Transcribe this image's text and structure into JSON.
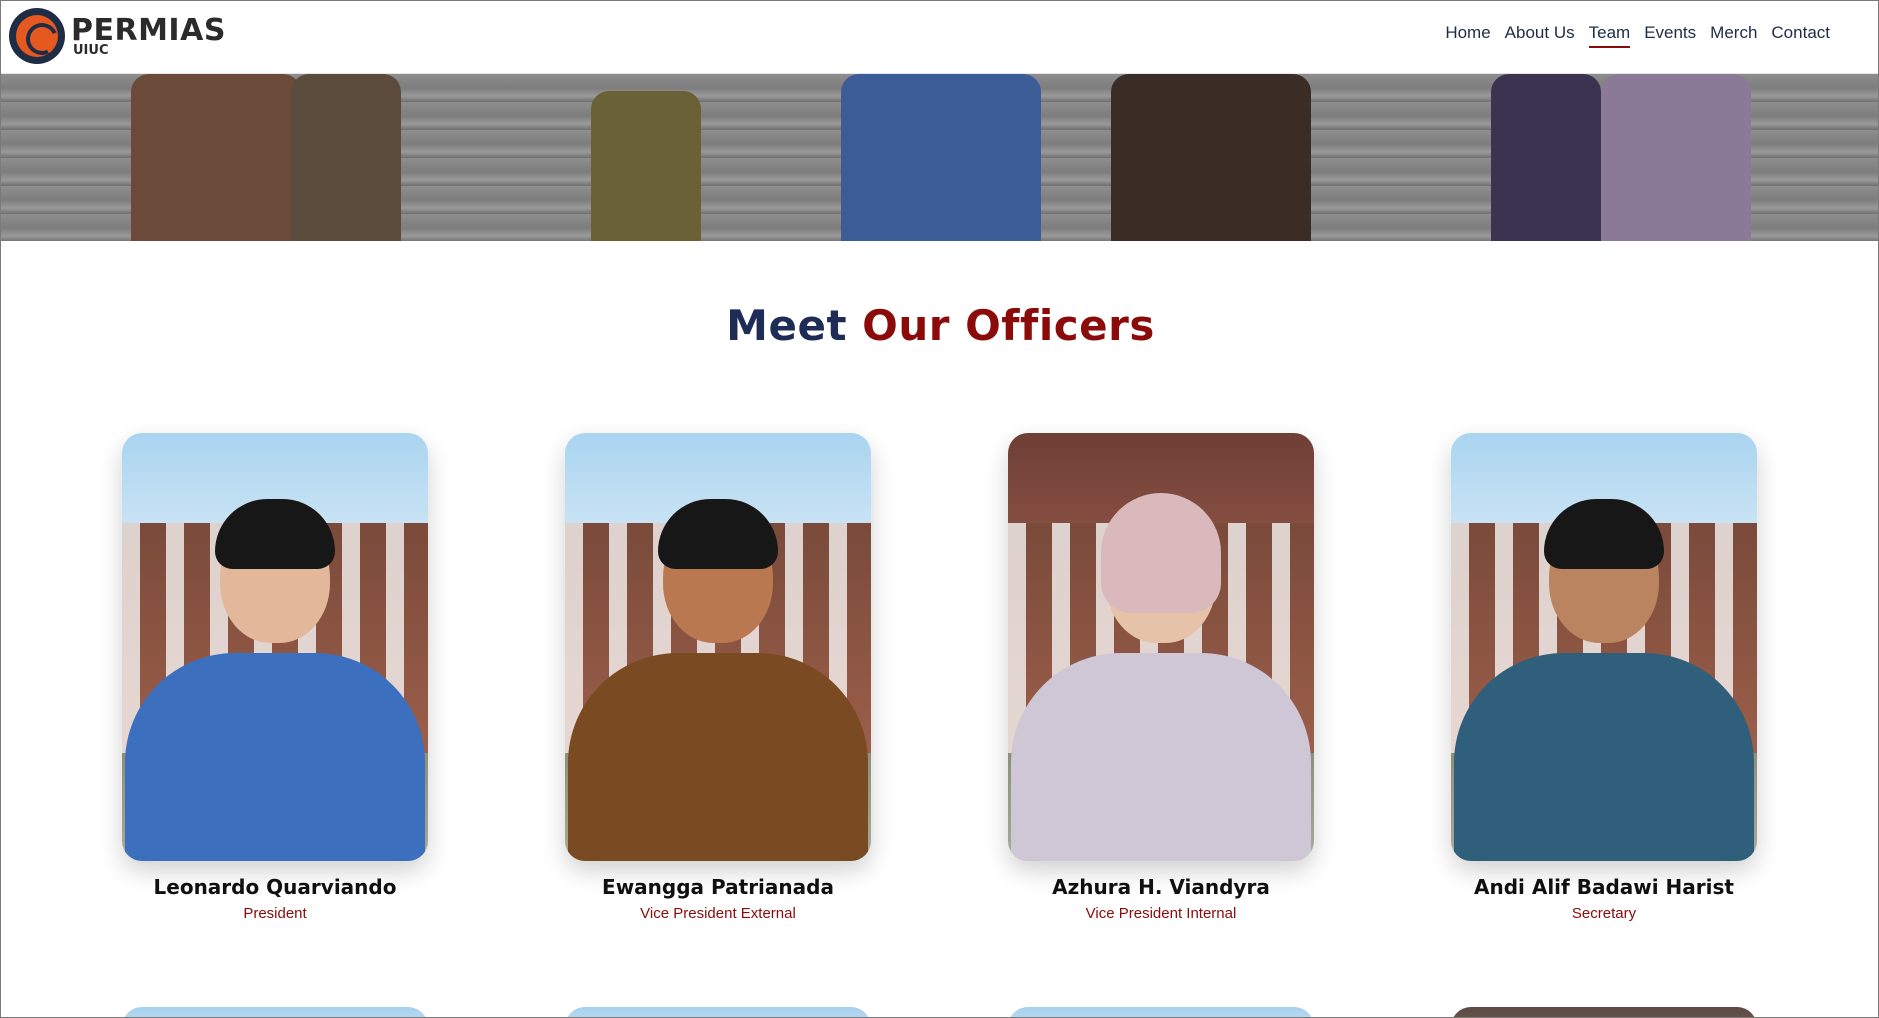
{
  "header": {
    "brand_title": "PERMIAS",
    "brand_sub": "UIUC",
    "nav": [
      {
        "label": "Home",
        "active": false
      },
      {
        "label": "About Us",
        "active": false
      },
      {
        "label": "Team",
        "active": true
      },
      {
        "label": "Events",
        "active": false
      },
      {
        "label": "Merch",
        "active": false
      },
      {
        "label": "Contact",
        "active": false
      }
    ]
  },
  "section": {
    "title_part1": "Meet",
    "title_part2": "Our Officers"
  },
  "officers": [
    {
      "name": "Leonardo Quarviando",
      "role": "President",
      "shirt": "#3d6fbf"
    },
    {
      "name": "Ewangga Patrianada",
      "role": "Vice President External",
      "shirt": "#7a4a22"
    },
    {
      "name": "Azhura H. Viandyra",
      "role": "Vice President Internal",
      "shirt": "#cfc6d6"
    },
    {
      "name": "Andi Alif Badawi Harist",
      "role": "Secretary",
      "shirt": "#2f5f7a"
    }
  ],
  "colors": {
    "navy": "#1f2c55",
    "accent_red": "#8b0a0a",
    "logo_orange": "#e5581f"
  }
}
